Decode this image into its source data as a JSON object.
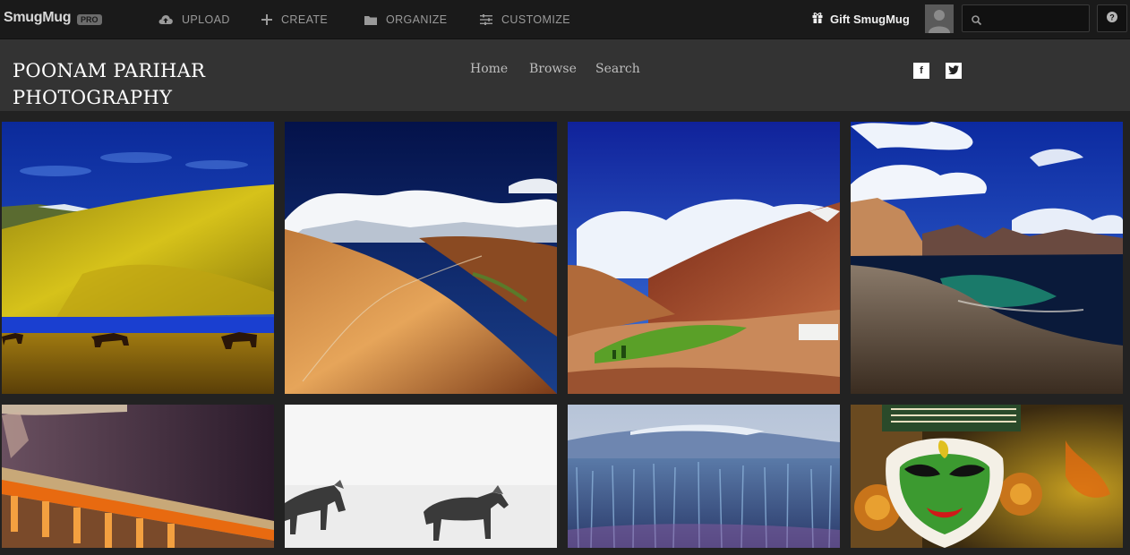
{
  "toolbar": {
    "logo": "SmugMug",
    "badge": "PRO",
    "upload": "UPLOAD",
    "create": "CREATE",
    "organize": "ORGANIZE",
    "customize": "CUSTOMIZE",
    "gift": "Gift SmugMug",
    "search_placeholder": ""
  },
  "header": {
    "title_line1": "POONAM PARIHAR",
    "title_line2": "PHOTOGRAPHY",
    "nav": {
      "home": "Home",
      "browse": "Browse",
      "search": "Search"
    },
    "social": {
      "facebook": "f",
      "twitter": "t"
    }
  },
  "gallery": {
    "photos": [
      "ladakh-yellow-hills-horses",
      "desert-mountain-road-clouds",
      "green-valley-red-mountains",
      "lake-shore-mountains",
      "orange-prayer-wheels",
      "white-horses-snow",
      "blue-pine-forest-hills",
      "kathakali-green-face"
    ]
  }
}
